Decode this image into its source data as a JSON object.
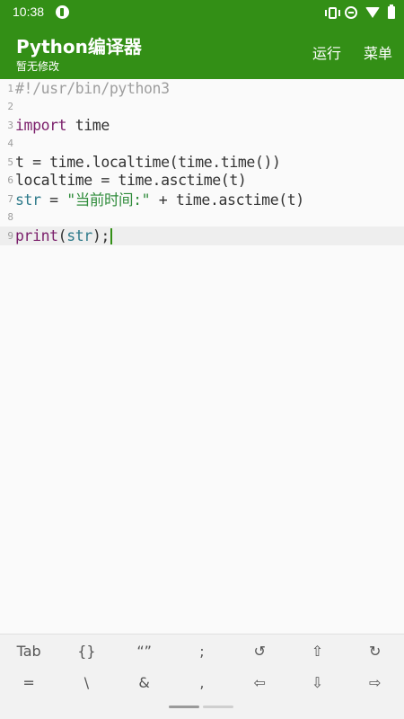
{
  "status_bar": {
    "time": "10:38",
    "icons": [
      "app-notification-icon",
      "vibrate-icon",
      "do-not-disturb-icon",
      "wifi-icon",
      "battery-icon"
    ]
  },
  "app_bar": {
    "title": "Python编译器",
    "subtitle": "暂无修改",
    "actions": {
      "run": "运行",
      "menu": "菜单"
    },
    "color": "#338f16"
  },
  "editor": {
    "current_line": 9,
    "lines": [
      {
        "num": "1",
        "tokens": [
          {
            "t": "#!/usr/bin/python3",
            "c": "comment"
          }
        ]
      },
      {
        "num": "2",
        "tokens": []
      },
      {
        "num": "3",
        "tokens": [
          {
            "t": "import",
            "c": "kw"
          },
          {
            "t": " time",
            "c": ""
          }
        ]
      },
      {
        "num": "4",
        "tokens": []
      },
      {
        "num": "5",
        "tokens": [
          {
            "t": "t = time.localtime(time.time())",
            "c": ""
          }
        ]
      },
      {
        "num": "6",
        "tokens": [
          {
            "t": "localtime = time.asctime(t)",
            "c": ""
          }
        ]
      },
      {
        "num": "7",
        "tokens": [
          {
            "t": "str",
            "c": "builtin"
          },
          {
            "t": " = ",
            "c": ""
          },
          {
            "t": "\"当前时间:\"",
            "c": "str"
          },
          {
            "t": " + time.asctime(t)",
            "c": ""
          }
        ]
      },
      {
        "num": "8",
        "tokens": []
      },
      {
        "num": "9",
        "tokens": [
          {
            "t": "print",
            "c": "kw"
          },
          {
            "t": "(",
            "c": ""
          },
          {
            "t": "str",
            "c": "builtin"
          },
          {
            "t": ");",
            "c": ""
          }
        ]
      }
    ]
  },
  "extra_keys": {
    "row1": [
      "Tab",
      "{}",
      "“”",
      ";",
      "↺",
      "⇧",
      "↻"
    ],
    "row2": [
      "=",
      "\\",
      "&",
      ",",
      "⇦",
      "⇩",
      "⇨"
    ]
  }
}
